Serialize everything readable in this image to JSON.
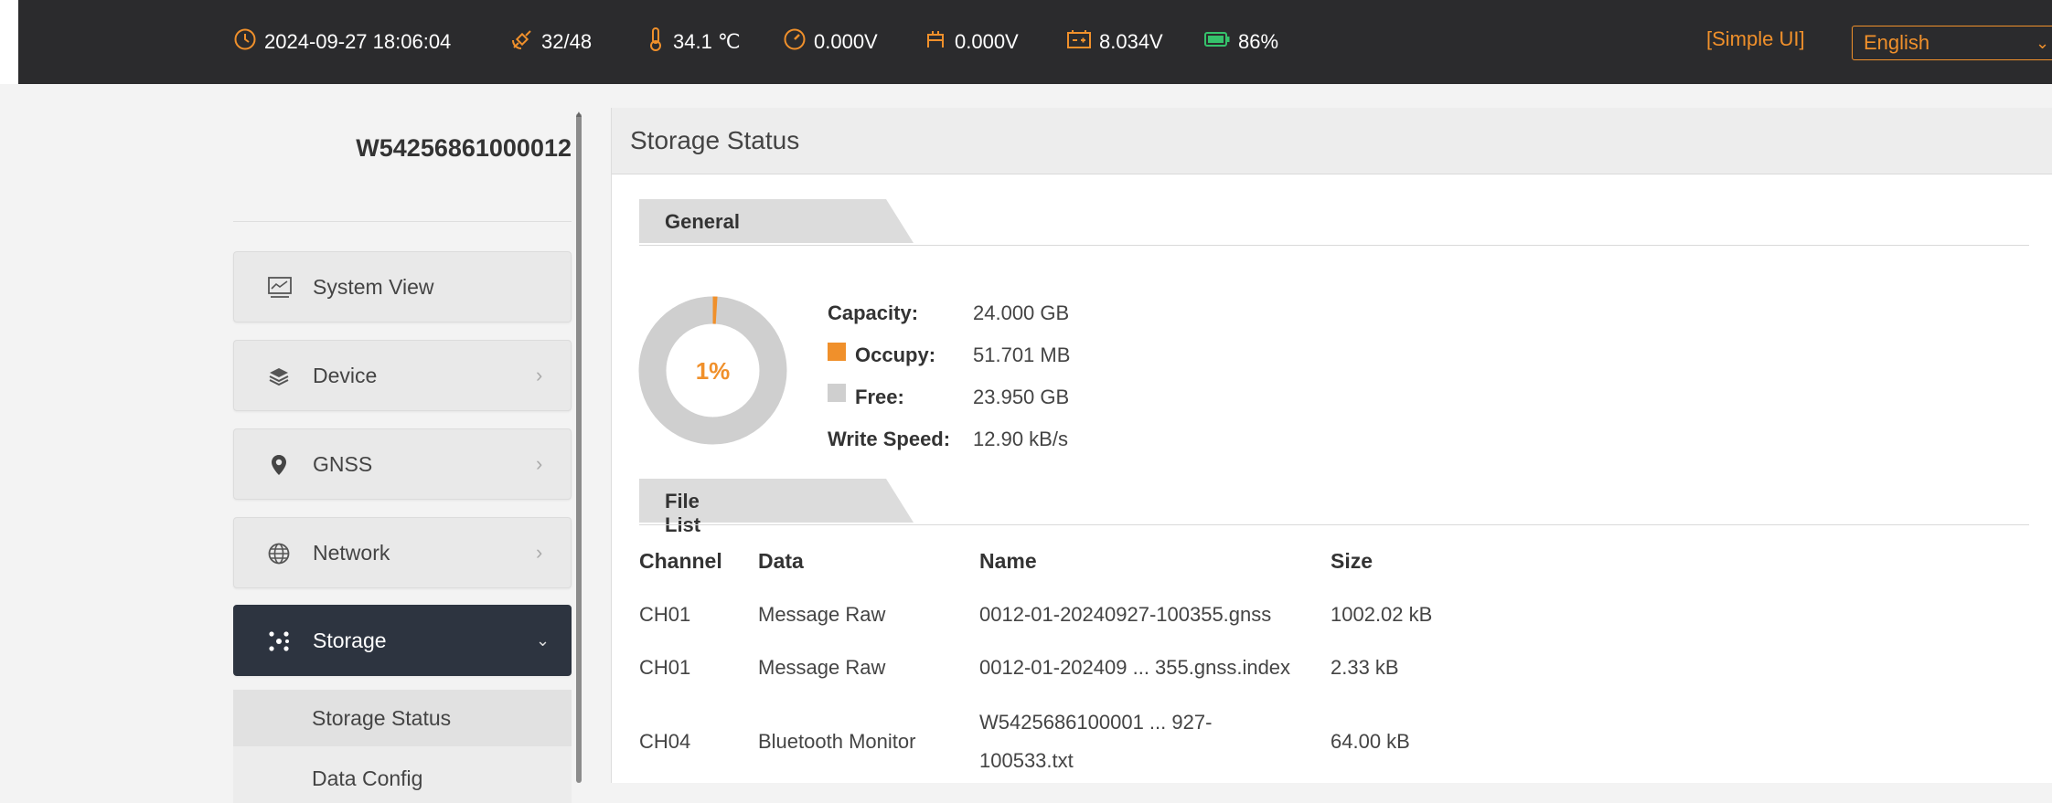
{
  "topbar": {
    "datetime": "2024-09-27 18:06:04",
    "satellites": "32/48",
    "temperature": "34.1 ℃",
    "voltage1": "0.000V",
    "voltage2": "0.000V",
    "voltage3": "8.034V",
    "battery": "86%",
    "simple_ui": "[Simple UI]",
    "language": "English",
    "accent_color": "#f0902b"
  },
  "sidebar": {
    "device_id": "W54256861000012",
    "items": [
      {
        "label": "System View",
        "icon": "monitor-chart-icon"
      },
      {
        "label": "Device",
        "icon": "layers-icon"
      },
      {
        "label": "GNSS",
        "icon": "location-pin-icon"
      },
      {
        "label": "Network",
        "icon": "globe-icon"
      },
      {
        "label": "Storage",
        "icon": "storage-icon"
      }
    ],
    "sub_items": [
      {
        "label": "Storage Status"
      },
      {
        "label": "Data Config"
      }
    ],
    "active_color": "#2d3440"
  },
  "main": {
    "title": "Storage Status",
    "general": {
      "tab_label": "General",
      "percent": "1%",
      "occupied_fraction": 0.01,
      "capacity_label": "Capacity:",
      "capacity_value": "24.000 GB",
      "occupy_label": "Occupy:",
      "occupy_value": "51.701 MB",
      "free_label": "Free:",
      "free_value": "23.950 GB",
      "write_speed_label": "Write Speed:",
      "write_speed_value": "12.90 kB/s",
      "occupy_color": "#f0902b",
      "free_color": "#cfcfcf"
    },
    "file_list": {
      "tab_label": "File List",
      "headers": [
        "Channel",
        "Data",
        "Name",
        "Size"
      ],
      "rows": [
        {
          "channel": "CH01",
          "data": "Message Raw",
          "name_line1": "0012-01-20240927-100355.gnss",
          "name_line2": "",
          "size": "1002.02 kB"
        },
        {
          "channel": "CH01",
          "data": "Message Raw",
          "name_line1": "0012-01-202409 ... 355.gnss.index",
          "name_line2": "",
          "size": "2.33 kB"
        },
        {
          "channel": "CH04",
          "data": "Bluetooth Monitor",
          "name_line1": "W5425686100001 ... 927-",
          "name_line2": "100533.txt",
          "size": "64.00 kB"
        }
      ]
    }
  }
}
